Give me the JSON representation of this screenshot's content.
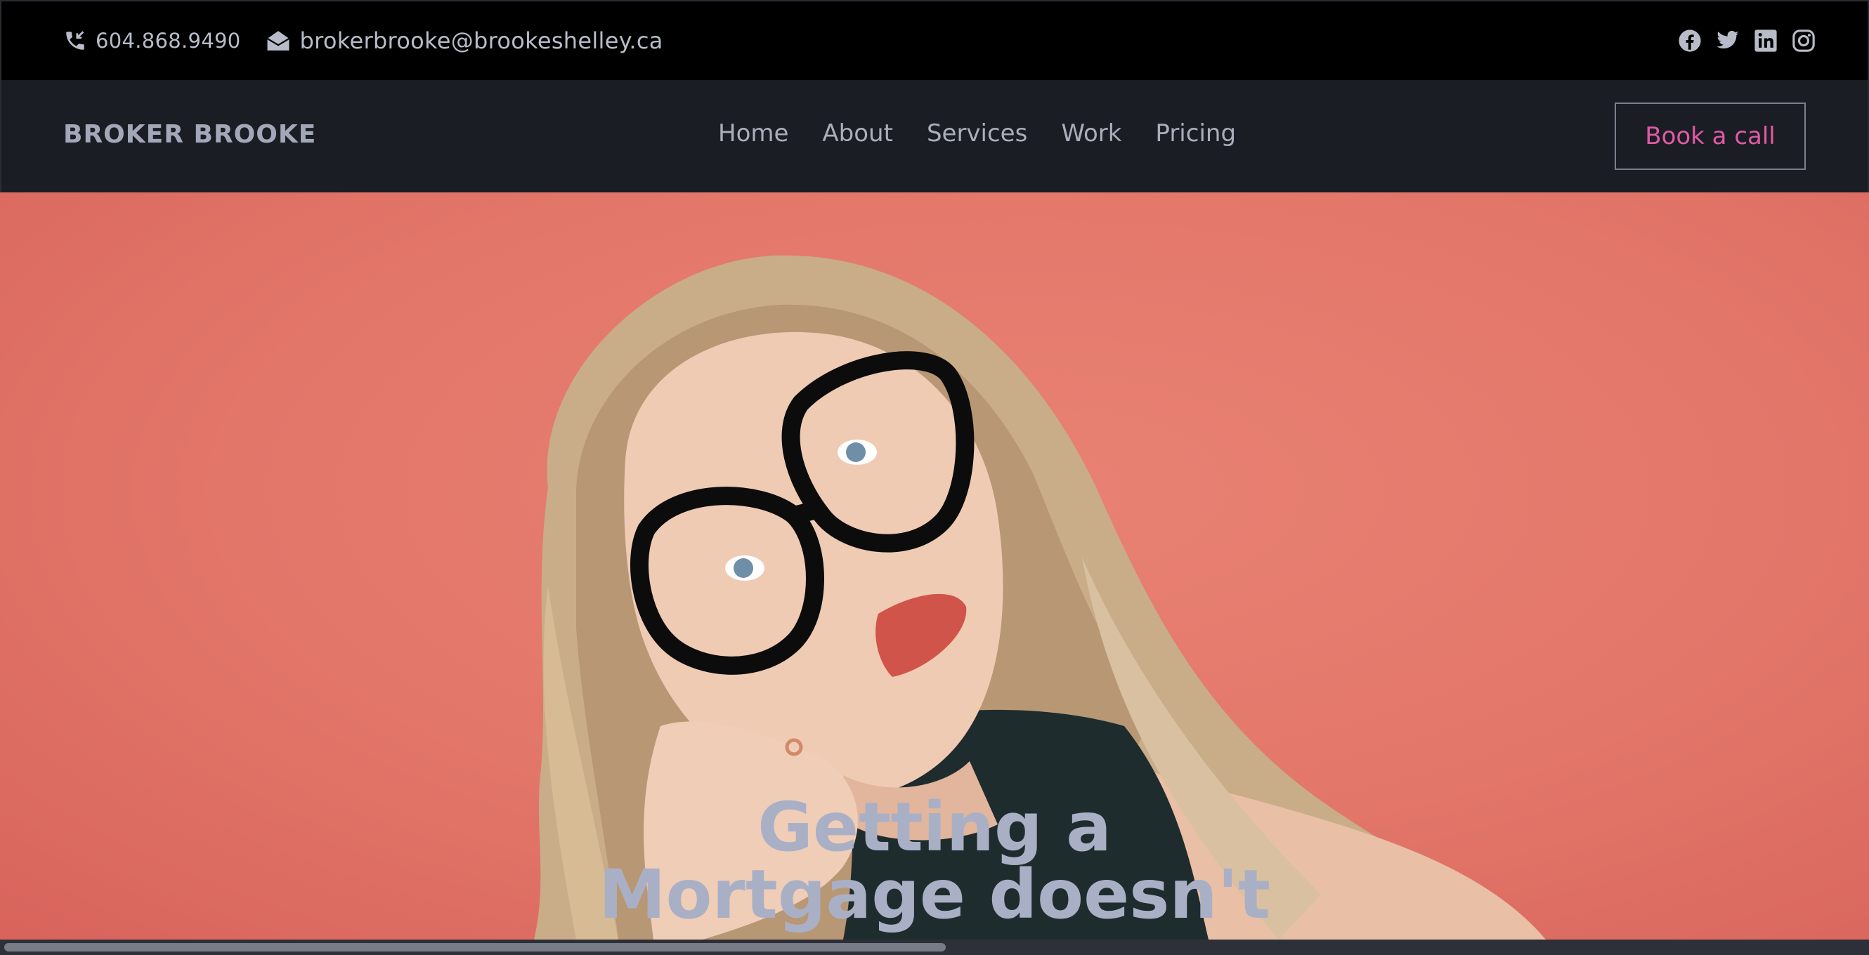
{
  "topbar": {
    "phone": "604.868.9490",
    "email": "brokerbrooke@brookeshelley.ca",
    "phone_icon": "phone-incoming-icon",
    "email_icon": "envelope-open-icon",
    "social": [
      "facebook-icon",
      "twitter-icon",
      "linkedin-icon",
      "instagram-icon"
    ]
  },
  "navbar": {
    "brand": "BROKER BROOKE",
    "links": [
      "Home",
      "About",
      "Services",
      "Work",
      "Pricing"
    ],
    "cta": "Book a call"
  },
  "hero": {
    "headline_line1": "Getting a",
    "headline_line2": "Mortgage doesn't"
  },
  "colors": {
    "topbar_bg": "#000000",
    "navbar_bg": "#1a1d24",
    "hero_bg": "#e27669",
    "cta_text": "#e05aa6",
    "headline_text": "#a9b0c6"
  }
}
